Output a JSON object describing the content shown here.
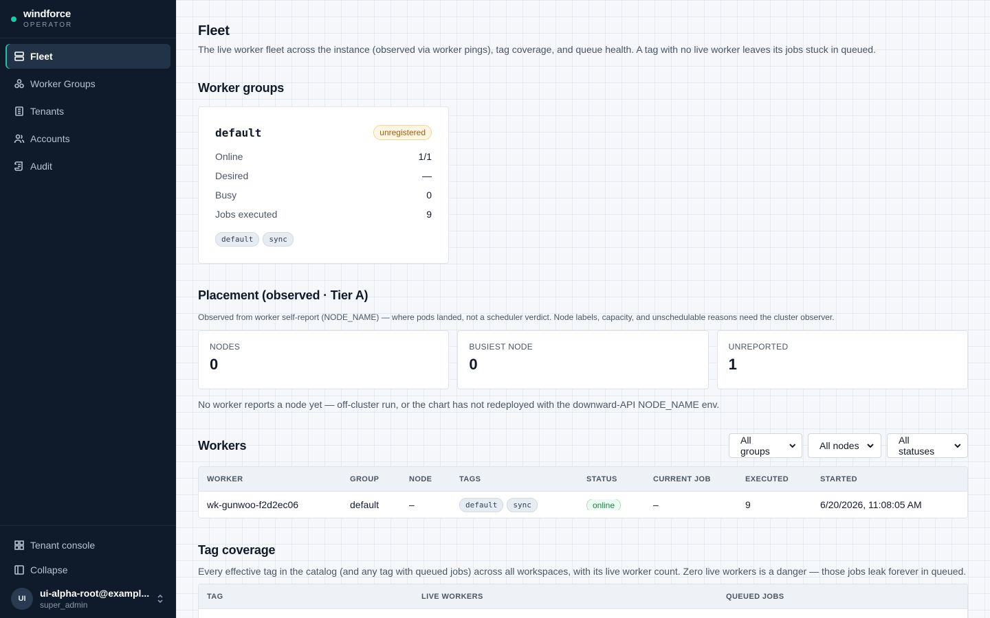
{
  "brand": {
    "name": "windforce",
    "sub": "OPERATOR"
  },
  "nav": [
    {
      "label": "Fleet",
      "icon": "server-icon"
    },
    {
      "label": "Worker Groups",
      "icon": "cluster-icon"
    },
    {
      "label": "Tenants",
      "icon": "building-icon"
    },
    {
      "label": "Accounts",
      "icon": "users-icon"
    },
    {
      "label": "Audit",
      "icon": "scroll-icon"
    }
  ],
  "sidebar_bottom": {
    "tenant_console": "Tenant console",
    "collapse": "Collapse"
  },
  "user": {
    "initials": "UI",
    "name": "ui-alpha-root@exampl...",
    "role": "super_admin"
  },
  "page": {
    "title": "Fleet",
    "description": "The live worker fleet across the instance (observed via worker pings), tag coverage, and queue health. A tag with no live worker leaves its jobs stuck in queued."
  },
  "worker_groups": {
    "title": "Worker groups",
    "card": {
      "name": "default",
      "badge": "unregistered",
      "rows": [
        {
          "k": "Online",
          "v": "1/1"
        },
        {
          "k": "Desired",
          "v": "—"
        },
        {
          "k": "Busy",
          "v": "0"
        },
        {
          "k": "Jobs executed",
          "v": "9"
        }
      ],
      "tags": [
        "default",
        "sync"
      ]
    }
  },
  "placement": {
    "title": "Placement (observed · Tier A)",
    "note": "Observed from worker self-report (NODE_NAME) — where pods landed, not a scheduler verdict. Node labels, capacity, and unschedulable reasons need the cluster observer.",
    "stats": [
      {
        "label": "NODES",
        "value": "0"
      },
      {
        "label": "BUSIEST NODE",
        "value": "0"
      },
      {
        "label": "UNREPORTED",
        "value": "1"
      }
    ],
    "footer": "No worker reports a node yet — off-cluster run, or the chart has not redeployed with the downward-API NODE_NAME env."
  },
  "workers": {
    "title": "Workers",
    "filters": [
      "All groups",
      "All nodes",
      "All statuses"
    ],
    "columns": [
      "WORKER",
      "GROUP",
      "NODE",
      "TAGS",
      "STATUS",
      "CURRENT JOB",
      "EXECUTED",
      "STARTED"
    ],
    "rows": [
      {
        "worker": "wk-gunwoo-f2d2ec06",
        "group": "default",
        "node": "–",
        "tags": [
          "default",
          "sync"
        ],
        "status": "online",
        "current_job": "–",
        "executed": "9",
        "started": "6/20/2026, 11:08:05 AM"
      }
    ]
  },
  "tag_coverage": {
    "title": "Tag coverage",
    "description": "Every effective tag in the catalog (and any tag with queued jobs) across all workspaces, with its live worker count. Zero live workers is a danger — those jobs leak forever in queued.",
    "columns": [
      "TAG",
      "LIVE WORKERS",
      "QUEUED JOBS"
    ]
  }
}
